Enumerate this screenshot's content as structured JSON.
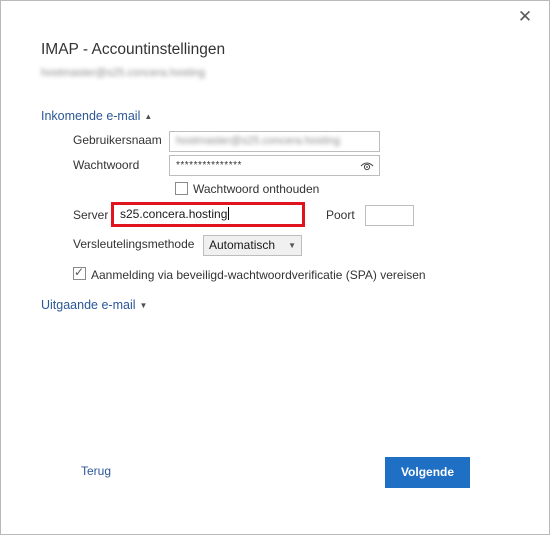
{
  "window": {
    "close_glyph": "✕",
    "title": "IMAP - Accountinstellingen",
    "account_email": "hostmaster@s25.concera.hosting"
  },
  "incoming": {
    "header": "Inkomende e-mail",
    "chevron_icon": "chevron-up-icon",
    "username_label": "Gebruikersnaam",
    "username_value": "hostmaster@s25.concera.hosting",
    "password_label": "Wachtwoord",
    "password_value": "***************",
    "remember_label": "Wachtwoord onthouden",
    "remember_checked": false,
    "server_label": "Server",
    "server_value": "s25.concera.hosting",
    "port_label": "Poort",
    "port_value": "",
    "encryption_label": "Versleutelingsmethode",
    "encryption_value": "Automatisch",
    "spa_label": "Aanmelding via beveiligd-wachtwoordverificatie (SPA) vereisen",
    "spa_checked": true
  },
  "outgoing": {
    "header": "Uitgaande e-mail",
    "chevron_icon": "chevron-down-icon"
  },
  "footer": {
    "back_label": "Terug",
    "next_label": "Volgende"
  },
  "colors": {
    "accent": "#1f6fc5",
    "link": "#2b5797",
    "highlight_border": "#e0141e"
  }
}
